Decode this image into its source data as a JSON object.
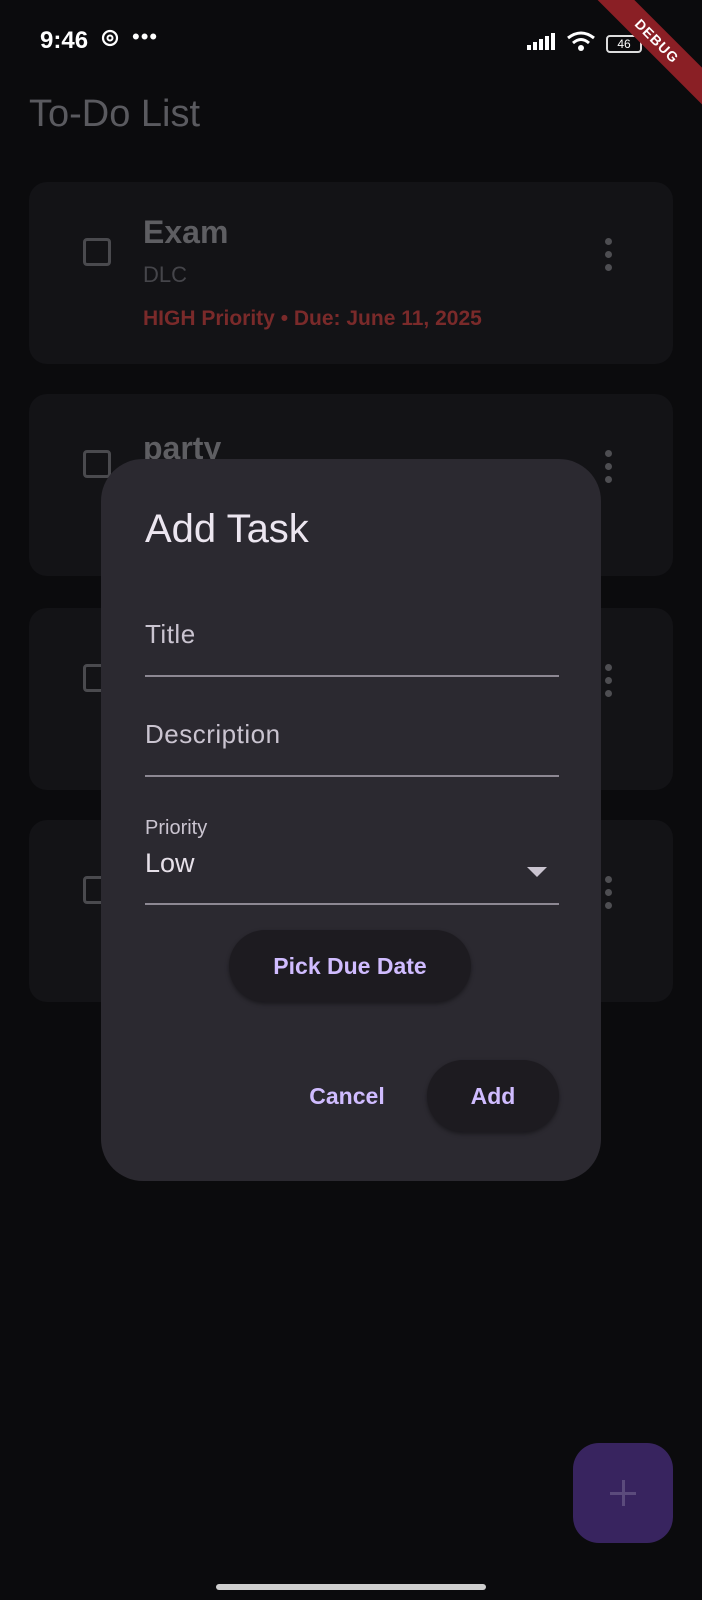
{
  "status_bar": {
    "time": "9:46",
    "notification_icon": "at-sign-icon",
    "more": "•••",
    "battery": "46",
    "debug_banner": "DEBUG"
  },
  "app": {
    "title": "To-Do List"
  },
  "tasks": [
    {
      "title": "Exam",
      "description": "DLC",
      "meta": "HIGH Priority • Due: June 11, 2025"
    },
    {
      "title": "party"
    }
  ],
  "dialog": {
    "title": "Add Task",
    "title_field_label": "Title",
    "description_field_label": "Description",
    "priority_label": "Priority",
    "priority_value": "Low",
    "pick_due_date": "Pick Due Date",
    "cancel": "Cancel",
    "add": "Add"
  },
  "colors": {
    "dialog_bg": "#2b2930",
    "accent": "#d0bcff",
    "priority_high": "#7a2a2a",
    "fab": "#38245f"
  }
}
